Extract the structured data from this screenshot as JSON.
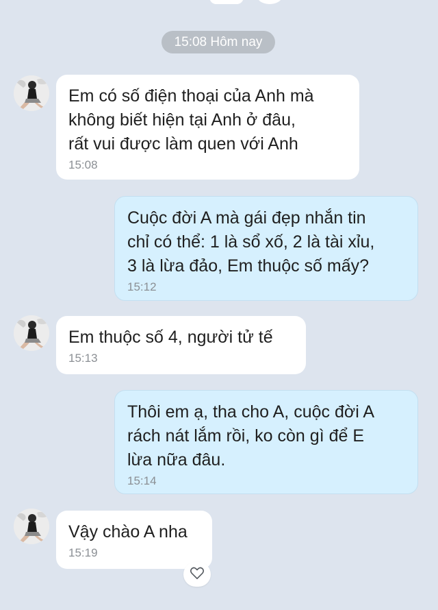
{
  "date_chip": "15:08 Hôm nay",
  "messages": [
    {
      "direction": "in",
      "text": "Em có số điện thoại của Anh mà\nkhông biết hiện tại Anh ở đâu,\nrất vui được làm quen với Anh",
      "time": "15:08"
    },
    {
      "direction": "out",
      "text": "Cuộc đời A mà gái đẹp nhắn tin\nchỉ có thể: 1 là sổ xố, 2 là tài xỉu,\n3 là lừa đảo, Em thuộc số mấy?",
      "time": "15:12"
    },
    {
      "direction": "in",
      "text": "Em thuộc số 4, người tử tế",
      "time": "15:13"
    },
    {
      "direction": "out",
      "text": "Thôi em ạ, tha cho A, cuộc đời A\nrách nát lắm rồi, ko còn gì để E\nlừa nữa đâu.",
      "time": "15:14"
    },
    {
      "direction": "in",
      "text": "Vậy chào A nha",
      "time": "15:19"
    }
  ],
  "reaction": {
    "icon": "heart-outline-icon"
  },
  "colors": {
    "background": "#dde4ee",
    "incoming_bubble": "#ffffff",
    "outgoing_bubble": "#d6f0fe",
    "date_chip": "#b9bfc6"
  }
}
